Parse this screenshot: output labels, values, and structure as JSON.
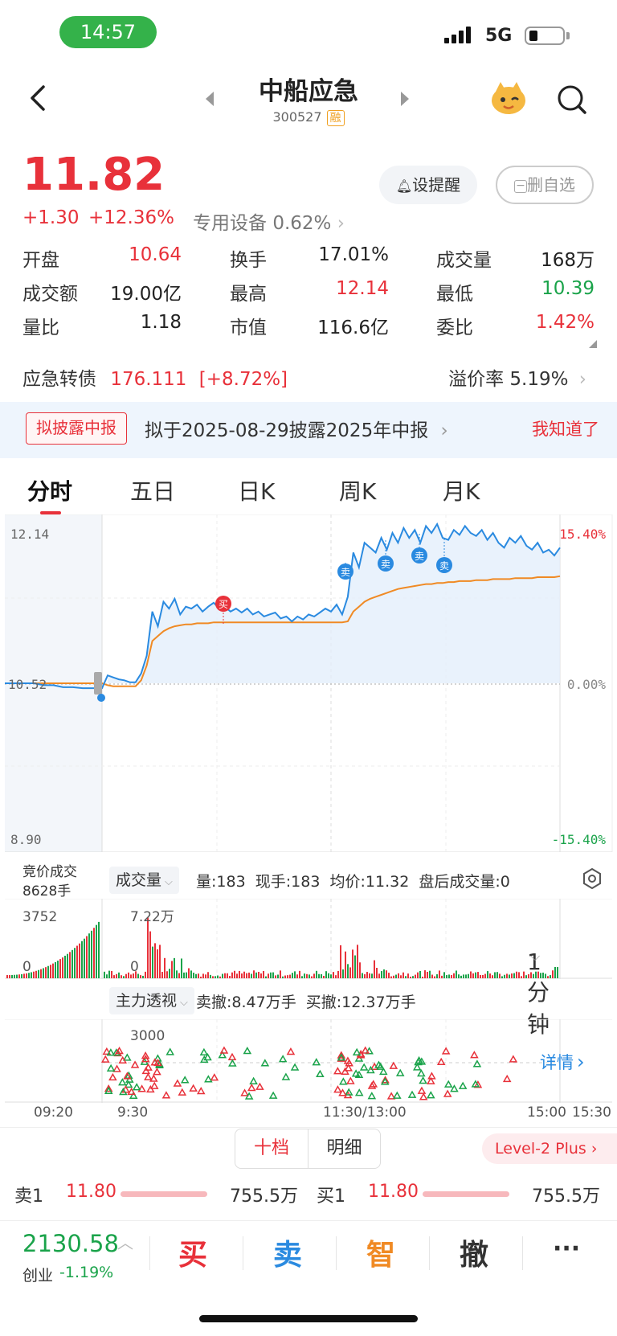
{
  "status": {
    "time": "14:57",
    "network": "5G"
  },
  "header": {
    "title": "中船应急",
    "code": "300527",
    "badge": "融"
  },
  "price": {
    "current": "11.82",
    "change": "+1.30",
    "change_pct": "+12.36%",
    "sector": "专用设备",
    "sector_pct": "0.62%"
  },
  "buttons": {
    "alert": "设提醒",
    "remove_watch": "删自选"
  },
  "stats": [
    {
      "label": "开盘",
      "value": "10.64",
      "color": "red"
    },
    {
      "label": "换手",
      "value": "17.01%",
      "color": "black"
    },
    {
      "label": "成交量",
      "value": "168万",
      "color": "black"
    },
    {
      "label": "成交额",
      "value": "19.00亿",
      "color": "black"
    },
    {
      "label": "最高",
      "value": "12.14",
      "color": "red"
    },
    {
      "label": "最低",
      "value": "10.39",
      "color": "green"
    },
    {
      "label": "量比",
      "value": "1.18",
      "color": "black"
    },
    {
      "label": "市值",
      "value": "116.6亿",
      "color": "black"
    },
    {
      "label": "委比",
      "value": "1.42%",
      "color": "red"
    }
  ],
  "bond": {
    "label": "应急转债",
    "price": "176.111",
    "pct": "[+8.72%]",
    "premium_label": "溢价率",
    "premium": "5.19%"
  },
  "notice": {
    "tag": "拟披露中报",
    "text": "拟于2025-08-29披露2025年中报",
    "dismiss": "我知道了"
  },
  "tabs": [
    "分时",
    "五日",
    "日K",
    "周K",
    "月K",
    "1分钟"
  ],
  "chart_axis": {
    "high": "12.14",
    "mid": "10.52",
    "low": "8.90",
    "pct_high": "15.40%",
    "pct_mid": "0.00%",
    "pct_low": "-15.40%"
  },
  "markers": {
    "buy": "买",
    "sell": "卖"
  },
  "volume_panel": {
    "auction_label": "竞价成交",
    "auction_value": "8628手",
    "selector": "成交量",
    "info": "量:183  现手:183  均价:11.32  盘后成交量:0",
    "left_max": "3752",
    "left_zero": "0",
    "right_max": "7.22万",
    "right_zero": "0"
  },
  "main_panel": {
    "selector": "主力透视",
    "info": "卖撤:8.47万手  买撤:12.37万手",
    "scale": "3000",
    "details": "详情"
  },
  "time_axis": [
    "09:20",
    "9:30",
    "11:30/13:00",
    "15:00",
    "15:30"
  ],
  "orderbook": {
    "tab_depth": "十档",
    "tab_detail": "明细",
    "level2": "Level-2 Plus",
    "sell1_label": "卖1",
    "sell1_price": "11.80",
    "sell1_vol": "755.5万",
    "buy1_label": "买1",
    "buy1_price": "11.80",
    "buy1_vol": "755.5万"
  },
  "bottom": {
    "index_value": "2130.58",
    "index_name": "创业",
    "index_pct": "-1.19%",
    "buy": "买",
    "sell": "卖",
    "smart": "智",
    "cancel": "撤",
    "more": "···"
  },
  "colors": {
    "up": "#e8313a",
    "down": "#1aa34a",
    "line": "#2a8ae0",
    "avg": "#f08a24"
  },
  "chart_data": {
    "type": "line",
    "series": [
      {
        "name": "",
        "values": [
          10.52,
          10.52,
          10.52,
          10.52,
          10.5,
          10.5,
          10.48,
          10.48,
          10.47,
          10.47,
          10.47,
          10.6,
          10.58,
          10.56,
          10.55,
          10.53,
          10.53,
          10.62,
          10.8,
          11.25,
          11.1,
          11.35,
          11.28,
          11.38,
          11.22,
          11.3,
          11.28,
          11.32,
          11.25,
          11.3,
          11.34,
          11.28,
          11.3,
          11.25,
          11.28,
          11.24,
          11.28,
          11.22,
          11.25,
          11.2,
          11.22,
          11.24,
          11.18,
          11.2,
          11.15,
          11.2,
          11.17,
          11.22,
          11.2,
          11.24,
          11.28,
          11.25,
          11.32,
          11.22,
          11.4,
          11.85,
          11.7,
          11.95,
          11.9,
          11.85,
          12.0,
          11.88,
          12.05,
          11.95,
          12.1,
          12.0,
          12.08,
          11.95,
          12.12,
          12.05,
          12.14,
          12.0,
          11.98,
          12.08,
          12.03,
          12.12,
          12.05,
          12.02,
          12.08,
          11.98,
          12.05,
          11.95,
          11.9,
          12.0,
          11.95,
          12.02,
          11.92,
          11.88,
          11.95,
          11.85,
          11.88,
          11.82,
          11.9
        ]
      },
      {
        "name": "",
        "values": [
          10.52,
          10.52,
          10.52,
          10.52,
          10.52,
          10.52,
          10.52,
          10.52,
          10.52,
          10.52,
          10.52,
          10.5,
          10.49,
          10.49,
          10.49,
          10.49,
          10.49,
          10.55,
          10.7,
          10.95,
          11.0,
          11.05,
          11.08,
          11.1,
          11.11,
          11.12,
          11.12,
          11.13,
          11.13,
          11.13,
          11.14,
          11.14,
          11.14,
          11.14,
          11.14,
          11.14,
          11.14,
          11.14,
          11.14,
          11.14,
          11.14,
          11.14,
          11.14,
          11.14,
          11.14,
          11.14,
          11.14,
          11.14,
          11.14,
          11.14,
          11.14,
          11.14,
          11.14,
          11.14,
          11.15,
          11.25,
          11.3,
          11.35,
          11.38,
          11.4,
          11.42,
          11.44,
          11.46,
          11.48,
          11.49,
          11.5,
          11.51,
          11.52,
          11.53,
          11.53,
          11.54,
          11.54,
          11.55,
          11.55,
          11.56,
          11.56,
          11.56,
          11.57,
          11.57,
          11.57,
          11.58,
          11.58,
          11.58,
          11.58,
          11.59,
          11.59,
          11.59,
          11.59,
          11.6,
          11.6,
          11.6,
          11.6,
          11.61
        ]
      }
    ],
    "ylim": [
      8.9,
      12.14
    ],
    "yticks": [
      "12.14",
      "10.52",
      "8.90"
    ]
  }
}
